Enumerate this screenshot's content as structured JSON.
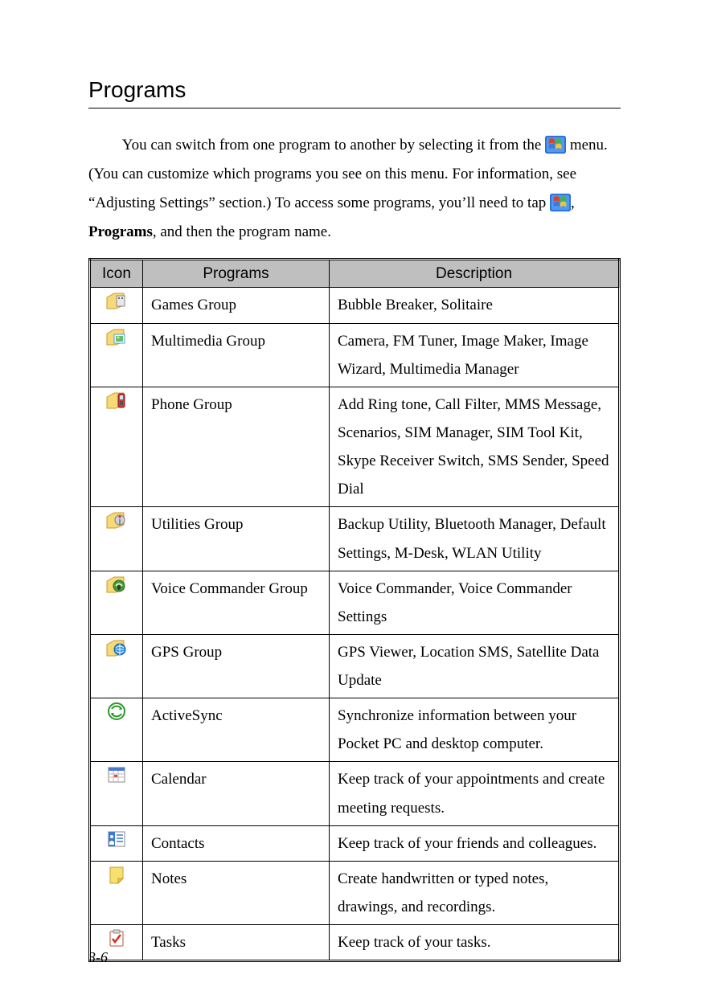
{
  "heading": "Programs",
  "intro": {
    "line1_before_icon": "You can switch from one program to another by selecting it from the",
    "line2": " menu. (You can customize which programs you see on this menu. For information, see “Adjusting Settings” section.) To access some programs, you’ll need to tap ",
    "programs_word": "Programs",
    "after_programs": ", and then the program name."
  },
  "table": {
    "headers": {
      "icon": "Icon",
      "programs": "Programs",
      "description": "Description"
    },
    "rows": [
      {
        "icon": "games-group-icon",
        "program": "Games Group",
        "description": "Bubble Breaker, Solitaire"
      },
      {
        "icon": "multimedia-group-icon",
        "program": "Multimedia Group",
        "description": "Camera, FM Tuner, Image Maker, Image Wizard, Multimedia Manager"
      },
      {
        "icon": "phone-group-icon",
        "program": "Phone Group",
        "description": "Add Ring tone, Call Filter, MMS Message, Scenarios, SIM Manager, SIM Tool Kit, Skype Receiver Switch, SMS Sender, Speed Dial"
      },
      {
        "icon": "utilities-group-icon",
        "program": "Utilities Group",
        "description": "Backup Utility, Bluetooth Manager, Default Settings, M-Desk, WLAN Utility"
      },
      {
        "icon": "voice-commander-icon",
        "program": "Voice Commander Group",
        "description": "Voice Commander, Voice Commander Settings"
      },
      {
        "icon": "gps-group-icon",
        "program": "GPS Group",
        "description": "GPS Viewer, Location SMS, Satellite Data Update"
      },
      {
        "icon": "activesync-icon",
        "program": "ActiveSync",
        "description": "Synchronize information between your Pocket PC and desktop computer."
      },
      {
        "icon": "calendar-icon",
        "program": "Calendar",
        "description": "Keep track of your appointments and create meeting requests."
      },
      {
        "icon": "contacts-icon",
        "program": "Contacts",
        "description": "Keep track of your friends and colleagues."
      },
      {
        "icon": "notes-icon",
        "program": "Notes",
        "description": "Create handwritten or typed notes, drawings, and recordings."
      },
      {
        "icon": "tasks-icon",
        "program": "Tasks",
        "description": "Keep track of your tasks."
      }
    ]
  },
  "page_number": "3-6"
}
